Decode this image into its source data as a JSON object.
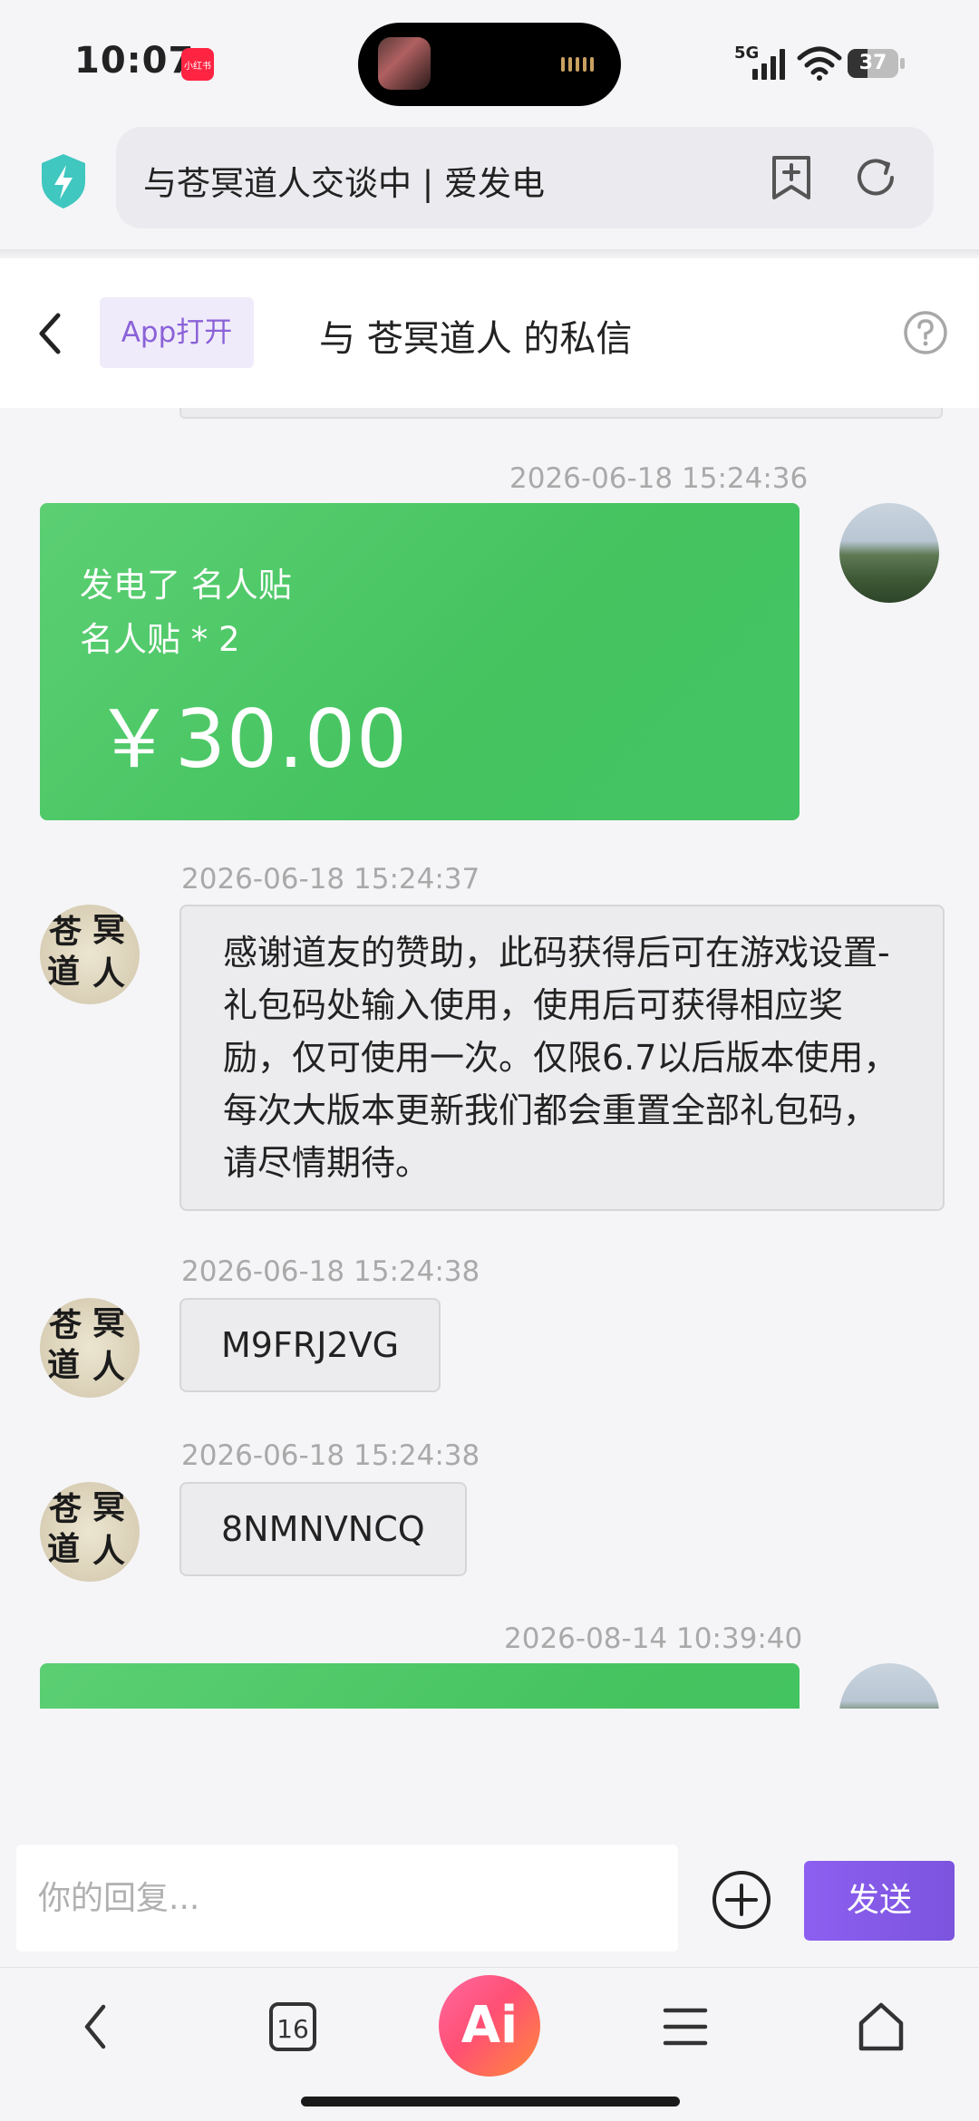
{
  "status_bar": {
    "time": "10:07",
    "app_badge": "小红书",
    "network": "5G",
    "battery": "37"
  },
  "browser": {
    "address_text": "与苍冥道人交谈中 | 爱发电"
  },
  "header": {
    "open_in_app": "App打开",
    "title": "与 苍冥道人 的私信"
  },
  "messages": [
    {
      "time": "2026-06-18 15:24:36",
      "type": "sponsor",
      "line1": "发电了 名人贴",
      "line2": "名人贴 * 2",
      "amount": "￥30.00"
    },
    {
      "time": "2026-06-18 15:24:37",
      "type": "text",
      "text": "感谢道友的赞助，此码获得后可在游戏设置-礼包码处输入使用，使用后可获得相应奖励，仅可使用一次。仅限6.7以后版本使用，每次大版本更新我们都会重置全部礼包码，请尽情期待。"
    },
    {
      "time": "2026-06-18 15:24:38",
      "type": "code",
      "text": "M9FRJ2VG"
    },
    {
      "time": "2026-06-18 15:24:38",
      "type": "code",
      "text": "8NMNVNCQ"
    },
    {
      "time": "2026-08-14 10:39:40",
      "type": "sponsor"
    }
  ],
  "avatar_text": {
    "c1": "苍",
    "c2": "冥",
    "c3": "道",
    "c4": "人"
  },
  "input": {
    "placeholder": "你的回复...",
    "send_label": "发送"
  },
  "bottom_nav": {
    "tabs_count": "16",
    "ai_label": "Ai"
  }
}
